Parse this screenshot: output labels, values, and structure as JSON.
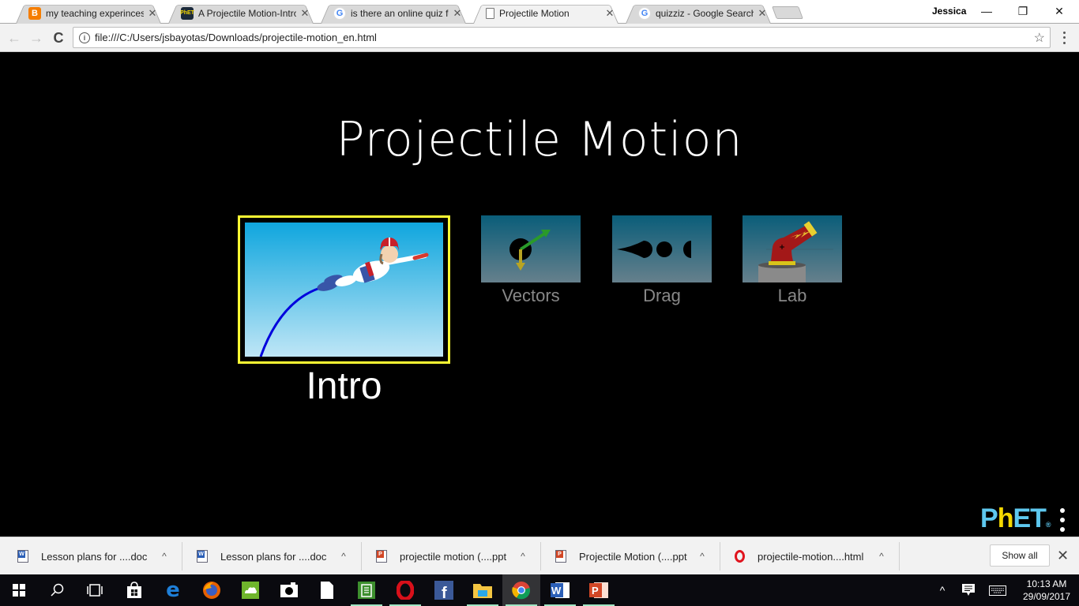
{
  "browser": {
    "tabs": [
      {
        "title": "my teaching experinces: ",
        "favicon": "blogger-icon",
        "active": false
      },
      {
        "title": "A Projectile Motion-Intro",
        "favicon": "phet-icon",
        "active": false
      },
      {
        "title": "is there an online quiz for",
        "favicon": "google-icon",
        "active": false
      },
      {
        "title": "Projectile Motion",
        "favicon": "document-icon",
        "active": true
      },
      {
        "title": "quizziz - Google Search",
        "favicon": "google-icon",
        "active": false
      }
    ],
    "profile_name": "Jessica",
    "window_controls": {
      "minimize": "—",
      "restore": "❐",
      "close": "✕"
    },
    "nav": {
      "back": "←",
      "forward": "→",
      "reload": "C"
    },
    "address": {
      "info_icon": "i",
      "url": "file:///C:/Users/jsbayotas/Downloads/projectile-motion_en.html",
      "star": "☆"
    }
  },
  "sim": {
    "title": "Projectile Motion",
    "screens": [
      {
        "label": "Intro",
        "selected": true,
        "icon": "intro-human-cannonball-icon"
      },
      {
        "label": "Vectors",
        "selected": false,
        "icon": "vectors-icon"
      },
      {
        "label": "Drag",
        "selected": false,
        "icon": "drag-shapes-icon"
      },
      {
        "label": "Lab",
        "selected": false,
        "icon": "cannon-icon"
      }
    ],
    "logo": {
      "p": "P",
      "h": "h",
      "et": "ET",
      "reg": "®"
    }
  },
  "downloads": {
    "items": [
      {
        "name": "Lesson plans for ....doc",
        "type": "word"
      },
      {
        "name": "Lesson plans for ....doc",
        "type": "word"
      },
      {
        "name": "projectile motion (....ppt",
        "type": "ppt"
      },
      {
        "name": "Projectile Motion (....ppt",
        "type": "ppt"
      },
      {
        "name": "projectile-motion....html",
        "type": "opera"
      }
    ],
    "caret": "^",
    "show_all": "Show all",
    "close": "✕"
  },
  "taskbar": {
    "apps": [
      "start",
      "search",
      "task-view",
      "store",
      "edge",
      "firefox",
      "cloud-app",
      "camera",
      "file",
      "notes",
      "opera",
      "facebook",
      "file-explorer",
      "chrome",
      "word",
      "powerpoint"
    ],
    "tray_chevron": "^",
    "time": "10:13 AM",
    "date": "29/09/2017"
  }
}
